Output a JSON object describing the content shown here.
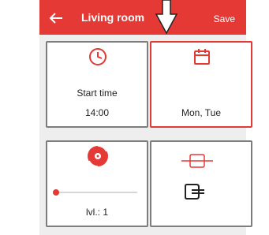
{
  "header": {
    "title": "Living room",
    "save_label": "Save",
    "back_icon": "arrow-left-icon",
    "pointer_icon": "down-arrow-pointer-icon",
    "color": "#e53935"
  },
  "cards": {
    "start_time": {
      "icon": "clock-icon",
      "label": "Start time",
      "value": "14:00"
    },
    "days": {
      "icon": "calendar-icon",
      "value": "Mon, Tue",
      "selected": true
    },
    "level": {
      "icon": "record-disc-icon",
      "value": "lvl.: 1",
      "slider_fraction": 0.0
    },
    "input": {
      "icons": [
        "switch-toggle-icon",
        "input-jack-icon"
      ]
    }
  },
  "colors": {
    "accent": "#e53935",
    "panel": "#eeeeee",
    "card_border": "#7d7d7d"
  }
}
